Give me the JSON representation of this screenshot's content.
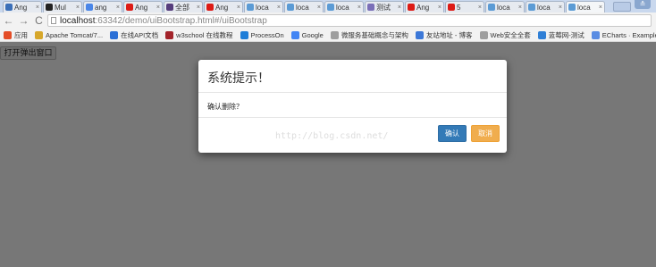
{
  "browser": {
    "tabs": [
      {
        "label": "Ang",
        "icon": "angularjs-icon",
        "color": "#3b6fb8"
      },
      {
        "label": "Mul",
        "icon": "github-icon",
        "color": "#222222"
      },
      {
        "label": "ang",
        "icon": "page-icon",
        "color": "#4a86e8"
      },
      {
        "label": "Ang",
        "icon": "angular-icon",
        "color": "#dd1b16"
      },
      {
        "label": "全部",
        "icon": "bootstrap-icon",
        "color": "#563d7c"
      },
      {
        "label": "Ang",
        "icon": "angular-icon",
        "color": "#dd1b16"
      },
      {
        "label": "loca",
        "icon": "page-icon",
        "color": "#5b9bd5"
      },
      {
        "label": "loca",
        "icon": "page-icon",
        "color": "#5b9bd5"
      },
      {
        "label": "loca",
        "icon": "page-icon",
        "color": "#5b9bd5"
      },
      {
        "label": "测试",
        "icon": "page-icon",
        "color": "#7a6fb8"
      },
      {
        "label": "Ang",
        "icon": "angular-icon",
        "color": "#dd1b16"
      },
      {
        "label": "5",
        "icon": "angular-icon",
        "color": "#dd1b16"
      },
      {
        "label": "loca",
        "icon": "page-icon",
        "color": "#5b9bd5"
      },
      {
        "label": "loca",
        "icon": "page-icon",
        "color": "#5b9bd5"
      },
      {
        "label": "loca",
        "icon": "page-icon",
        "color": "#5b9bd5"
      }
    ],
    "active_tab_index": 14,
    "tab_close": "×",
    "profile_label": "≗",
    "nav": {
      "back": "←",
      "forward": "→",
      "reload": "C"
    },
    "address": {
      "host": "localhost",
      "path": ":63342/demo/uiBootstrap.html#/uiBootstrap"
    },
    "bookmarks": [
      {
        "label": "应用",
        "icon": "apps-grid-icon",
        "color": "#e44d26"
      },
      {
        "label": "Apache Tomcat/7...",
        "icon": "tomcat-icon",
        "color": "#d7a72a"
      },
      {
        "label": "在线API文档",
        "icon": "api-doc-icon",
        "color": "#2a6fd6"
      },
      {
        "label": "w3school 在线教程",
        "icon": "w3school-icon",
        "color": "#a3242a"
      },
      {
        "label": "ProcessOn",
        "icon": "processon-icon",
        "color": "#1f7ed8"
      },
      {
        "label": "Google",
        "icon": "google-icon",
        "color": "#4285f4"
      },
      {
        "label": "微服务基础概念与架构",
        "icon": "page-icon",
        "color": "#9e9e9e"
      },
      {
        "label": "友站地址 - 博客",
        "icon": "blog-icon",
        "color": "#3c78d8"
      },
      {
        "label": "Web安全全套",
        "icon": "page-icon",
        "color": "#9e9e9e"
      },
      {
        "label": "蓝莓网-测试",
        "icon": "link-icon",
        "color": "#2f7fd6"
      },
      {
        "label": "ECharts · Example",
        "icon": "echarts-icon",
        "color": "#5a8de3"
      }
    ]
  },
  "page": {
    "open_button_label": "打开弹出窗口",
    "modal": {
      "title": "系统提示！",
      "message": "确认删除？",
      "watermark": "http://blog.csdn.net/",
      "ok_label": "确认",
      "cancel_label": "取消"
    }
  },
  "colors": {
    "overlay": "#777777",
    "primary": "#337ab7",
    "warning": "#f0ad4e"
  }
}
